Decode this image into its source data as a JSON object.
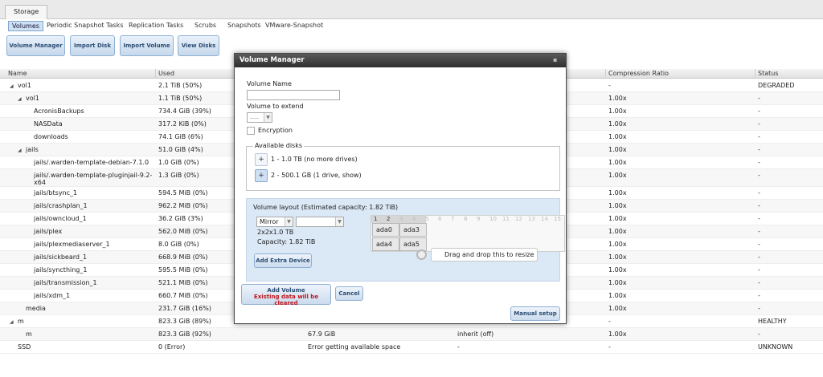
{
  "tabs": {
    "storage": "Storage"
  },
  "subtabs": [
    "Volumes",
    "Periodic Snapshot Tasks",
    "Replication Tasks",
    "Scrubs",
    "Snapshots",
    "VMware-Snapshot"
  ],
  "toolbar": {
    "volume_manager": "Volume Manager",
    "import_disk": "Import Disk",
    "import_volume": "Import Volume",
    "view_disks": "View Disks"
  },
  "table": {
    "headers": [
      "Name",
      "Used",
      "Compression Ratio",
      "Status"
    ],
    "rows": [
      {
        "name": "vol1",
        "used": "2.1 TiB (50%)",
        "avail": "",
        "comp": "",
        "ratio": "-",
        "status": "DEGRADED"
      },
      {
        "name": "vol1",
        "used": "1.1 TiB (50%)",
        "avail": "",
        "comp": "",
        "ratio": "1.00x",
        "status": "-"
      },
      {
        "name": "AcronisBackups",
        "used": "734.4 GiB (39%)",
        "avail": "",
        "comp": "",
        "ratio": "1.00x",
        "status": "-"
      },
      {
        "name": "NASData",
        "used": "317.2 KiB (0%)",
        "avail": "",
        "comp": "",
        "ratio": "1.00x",
        "status": "-"
      },
      {
        "name": "downloads",
        "used": "74.1 GiB (6%)",
        "avail": "",
        "comp": "",
        "ratio": "1.00x",
        "status": "-"
      },
      {
        "name": "jails",
        "used": "51.0 GiB (4%)",
        "avail": "",
        "comp": "",
        "ratio": "1.00x",
        "status": "-"
      },
      {
        "name": "jails/.warden-template-debian-7.1.0",
        "used": "1.0 GiB (0%)",
        "avail": "",
        "comp": "",
        "ratio": "1.00x",
        "status": "-"
      },
      {
        "name": "jails/.warden-template-pluginjail-9.2-x64",
        "used": "1.3 GiB (0%)",
        "avail": "",
        "comp": "",
        "ratio": "1.00x",
        "status": "-"
      },
      {
        "name": "jails/btsync_1",
        "used": "594.5 MiB (0%)",
        "avail": "",
        "comp": "",
        "ratio": "1.00x",
        "status": "-"
      },
      {
        "name": "jails/crashplan_1",
        "used": "962.2 MiB (0%)",
        "avail": "",
        "comp": "",
        "ratio": "1.00x",
        "status": "-"
      },
      {
        "name": "jails/owncloud_1",
        "used": "36.2 GiB (3%)",
        "avail": "",
        "comp": "",
        "ratio": "1.00x",
        "status": "-"
      },
      {
        "name": "jails/plex",
        "used": "562.0 MiB (0%)",
        "avail": "",
        "comp": "",
        "ratio": "1.00x",
        "status": "-"
      },
      {
        "name": "jails/plexmediaserver_1",
        "used": "8.0 GiB (0%)",
        "avail": "",
        "comp": "",
        "ratio": "1.00x",
        "status": "-"
      },
      {
        "name": "jails/sickbeard_1",
        "used": "668.9 MiB (0%)",
        "avail": "",
        "comp": "",
        "ratio": "1.00x",
        "status": "-"
      },
      {
        "name": "jails/syncthing_1",
        "used": "595.5 MiB (0%)",
        "avail": "",
        "comp": "",
        "ratio": "1.00x",
        "status": "-"
      },
      {
        "name": "jails/transmission_1",
        "used": "521.1 MiB (0%)",
        "avail": "",
        "comp": "",
        "ratio": "1.00x",
        "status": "-"
      },
      {
        "name": "jails/xdm_1",
        "used": "660.7 MiB (0%)",
        "avail": "",
        "comp": "",
        "ratio": "1.00x",
        "status": "-"
      },
      {
        "name": "media",
        "used": "231.7 GiB (16%)",
        "avail": "",
        "comp": "",
        "ratio": "1.00x",
        "status": "-"
      },
      {
        "name": "m",
        "used": "823.3 GiB (89%)",
        "avail": "",
        "comp": "",
        "ratio": "-",
        "status": "HEALTHY"
      },
      {
        "name": "m",
        "used": "823.3 GiB (92%)",
        "avail": "67.9 GiB",
        "comp": "inherit (off)",
        "ratio": "1.00x",
        "status": "-"
      },
      {
        "name": "SSD",
        "used": "0 (Error)",
        "avail": "Error getting available space",
        "comp": "-",
        "ratio": "-",
        "status": "UNKNOWN"
      }
    ]
  },
  "dialog": {
    "title": "Volume Manager",
    "volume_name_label": "Volume Name",
    "volume_name_value": "",
    "volume_extend_label": "Volume to extend",
    "volume_extend_value": "-----",
    "encryption_label": "Encryption",
    "available_disks_legend": "Available disks",
    "disk_groups": [
      {
        "plus": "+",
        "label": "1 - 1.0 TB (no more drives)"
      },
      {
        "plus": "+",
        "label": "2 - 500.1 GB (1 drive, show)"
      }
    ],
    "volume_layout_legend": "Volume layout (Estimated capacity: 1.82 TiB)",
    "layout_type": "Mirror",
    "layout_second": "",
    "layout_size": "2x2x1.0 TB",
    "layout_capacity": "Capacity: 1.82 TiB",
    "add_extra_device": "Add Extra Device",
    "grid_cols": [
      "1",
      "2",
      "3",
      "4",
      "5",
      "6",
      "7",
      "8",
      "9",
      "10",
      "11",
      "12",
      "13",
      "14",
      "15"
    ],
    "disks": [
      "ada0",
      "ada3",
      "ada4",
      "ada5"
    ],
    "tooltip": "Drag and drop this to resize",
    "add_volume": "Add Volume",
    "add_volume_warning": "Existing data will be cleared",
    "cancel": "Cancel",
    "manual_setup": "Manual setup"
  }
}
